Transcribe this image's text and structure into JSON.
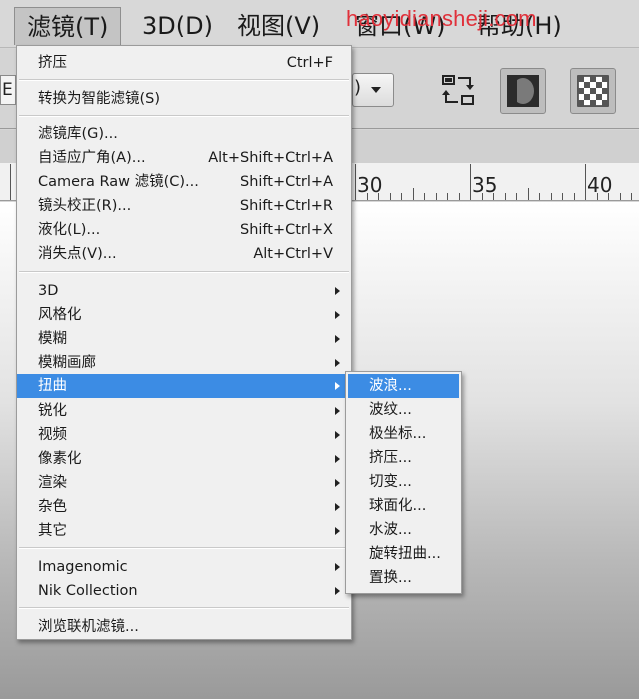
{
  "menubar": {
    "items": [
      {
        "label": "滤镜(T)"
      },
      {
        "label": "3D(D)"
      },
      {
        "label": "视图(V)"
      },
      {
        "label": "窗口(W)"
      },
      {
        "label": "帮助(H)"
      }
    ],
    "watermark": "haoyidiansheji.com"
  },
  "options_bar": {
    "left_fragment": "E",
    "dropdown_edge": ")"
  },
  "ruler": {
    "labels": [
      "30",
      "35",
      "40"
    ]
  },
  "filter_menu": {
    "items": [
      {
        "label": "挤压",
        "shortcut": "Ctrl+F"
      },
      {
        "label": "转换为智能滤镜(S)",
        "shortcut": ""
      },
      {
        "label": "滤镜库(G)...",
        "shortcut": ""
      },
      {
        "label": "自适应广角(A)...",
        "shortcut": "Alt+Shift+Ctrl+A"
      },
      {
        "label": "Camera Raw 滤镜(C)...",
        "shortcut": "Shift+Ctrl+A"
      },
      {
        "label": "镜头校正(R)...",
        "shortcut": "Shift+Ctrl+R"
      },
      {
        "label": "液化(L)...",
        "shortcut": "Shift+Ctrl+X"
      },
      {
        "label": "消失点(V)...",
        "shortcut": "Alt+Ctrl+V"
      },
      {
        "label": "3D",
        "shortcut": ""
      },
      {
        "label": "风格化",
        "shortcut": ""
      },
      {
        "label": "模糊",
        "shortcut": ""
      },
      {
        "label": "模糊画廊",
        "shortcut": ""
      },
      {
        "label": "扭曲",
        "shortcut": ""
      },
      {
        "label": "锐化",
        "shortcut": ""
      },
      {
        "label": "视频",
        "shortcut": ""
      },
      {
        "label": "像素化",
        "shortcut": ""
      },
      {
        "label": "渲染",
        "shortcut": ""
      },
      {
        "label": "杂色",
        "shortcut": ""
      },
      {
        "label": "其它",
        "shortcut": ""
      },
      {
        "label": "Imagenomic",
        "shortcut": ""
      },
      {
        "label": "Nik Collection",
        "shortcut": ""
      },
      {
        "label": "浏览联机滤镜...",
        "shortcut": ""
      }
    ],
    "highlighted": "扭曲"
  },
  "distort_submenu": {
    "items": [
      {
        "label": "波浪..."
      },
      {
        "label": "波纹..."
      },
      {
        "label": "极坐标..."
      },
      {
        "label": "挤压..."
      },
      {
        "label": "切变..."
      },
      {
        "label": "球面化..."
      },
      {
        "label": "水波..."
      },
      {
        "label": "旋转扭曲..."
      },
      {
        "label": "置换..."
      }
    ],
    "highlighted": "波浪..."
  },
  "colors": {
    "highlight": "#3c8ce4",
    "watermark": "#e0303a"
  }
}
